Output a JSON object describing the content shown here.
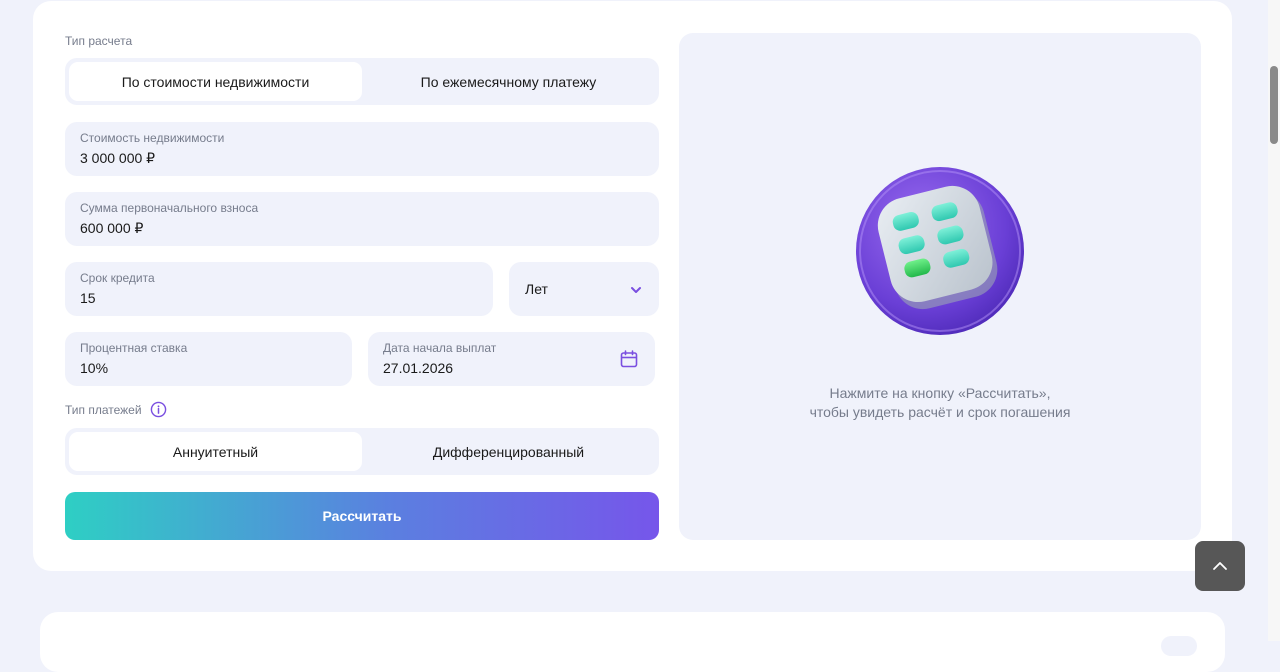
{
  "calc_type": {
    "label": "Тип расчета",
    "options": [
      "По стоимости недвижимости",
      "По ежемесячному платежу"
    ],
    "selected": 0
  },
  "fields": {
    "property_cost": {
      "label": "Стоимость недвижимости",
      "value": "3 000 000 ₽"
    },
    "down_payment": {
      "label": "Сумма первоначального взноса",
      "value": "600 000 ₽"
    },
    "term": {
      "label": "Срок кредита",
      "value": "15"
    },
    "term_unit": {
      "value": "Лет"
    },
    "interest_rate": {
      "label": "Процентная ставка",
      "value": "10%"
    },
    "start_date": {
      "label": "Дата начала выплат",
      "value": "27.01.2026"
    }
  },
  "payment_type": {
    "label": "Тип платежей",
    "options": [
      "Аннуитетный",
      "Дифференцированный"
    ],
    "selected": 0
  },
  "calculate_button": {
    "label": "Рассчитать"
  },
  "result_panel": {
    "hint_line1": "Нажмите на кнопку «Рассчитать»,",
    "hint_line2": "чтобы увидеть расчёт и срок погашения"
  },
  "colors": {
    "accent": "#7a4fe0",
    "panel_bg": "#f0f2fb",
    "gradient_start": "#2ecfc4",
    "gradient_end": "#7656ea"
  }
}
